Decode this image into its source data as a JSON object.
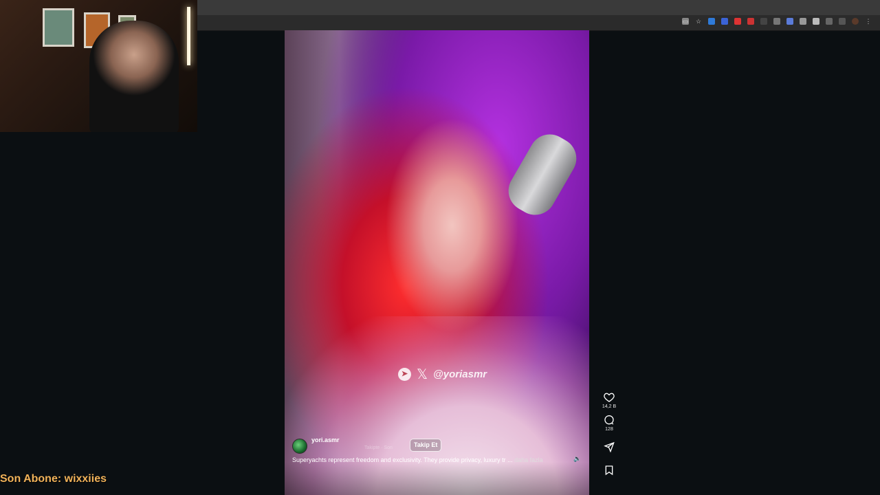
{
  "video": {
    "watermark_handle": "@yoriasmr",
    "username": "yori.asmr",
    "faded_meta": "Takipte · Son",
    "follow_label": "Takip Et",
    "caption": "Superyachts represent freedom and exclusivity. They provide privacy, luxury tr ...",
    "more_label": "daha fazla"
  },
  "actions": {
    "likes": "14,2 B",
    "comments": "128"
  },
  "overlay": {
    "subscriber_text": "Son Abone: wixxiies"
  },
  "icons": [
    "heart-icon",
    "comment-icon",
    "share-icon",
    "bookmark-icon",
    "telegram-icon",
    "x-logo-icon",
    "volume-icon",
    "star-icon",
    "cast-icon"
  ],
  "colors": {
    "page_bg": "#0b0f12",
    "subscriber_text": "#f2b35a",
    "follow_border": "#ffffff"
  }
}
